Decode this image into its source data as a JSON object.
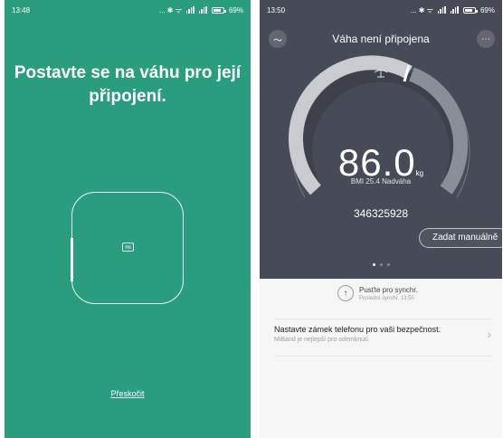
{
  "left_screen": {
    "status": {
      "time": "13:48",
      "signal_icons": "... ✱ ᯤ",
      "battery": "69%"
    },
    "title": "Postavte se na váhu pro její připojení.",
    "skip_label": "Přeskočit"
  },
  "right_screen": {
    "status": {
      "time": "13:50",
      "signal_icons": "... ✱ ᯤ",
      "battery": "69%"
    },
    "header_title": "Váha není připojena",
    "weight_value": "86.0",
    "weight_unit": "kg",
    "bmi_text": "BMI 25.4 Nadváha",
    "scale_id": "346325928",
    "manual_button": "Zadat manuálně",
    "sync_title": "Pusťte pro synchr.",
    "sync_subtitle": "Poslední synchr. 13:50",
    "lock_title": "Nastavte zámek telefonu pro vaši bezpečnost.",
    "lock_subtitle": "MiBand je nejlepší pro odemknutí.",
    "colors": {
      "left_bg": "#2a9d7e",
      "dark_bg": "#474b57"
    }
  }
}
